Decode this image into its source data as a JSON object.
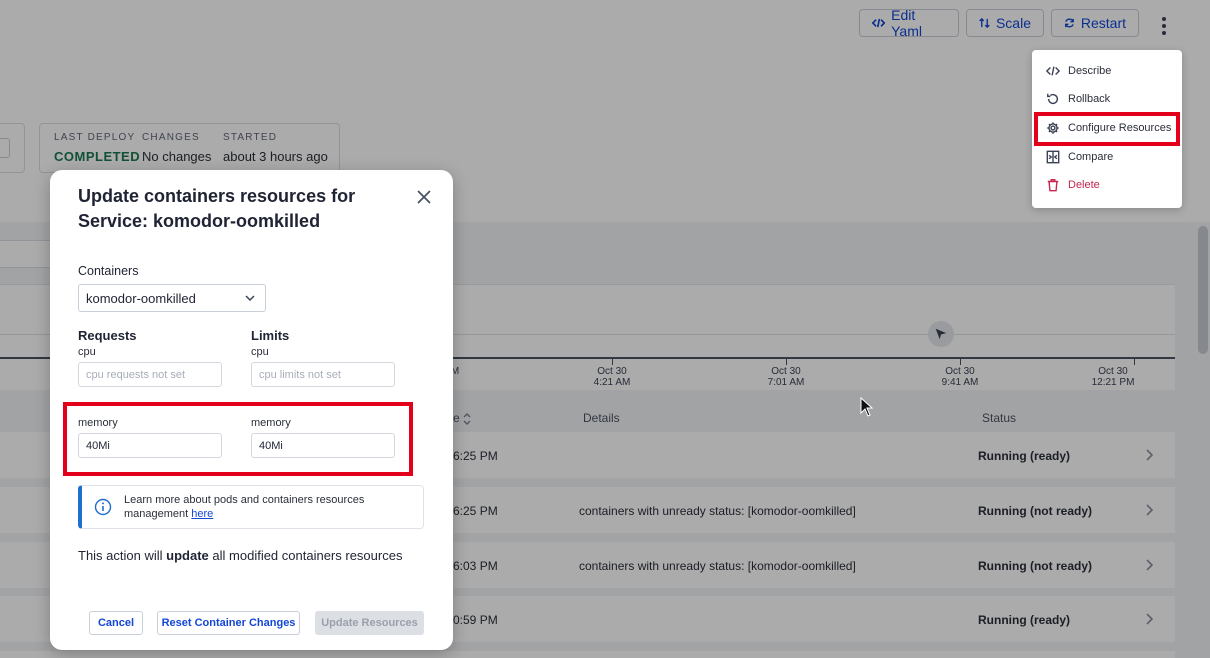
{
  "toolbar": {
    "edit_yaml": "Edit Yaml",
    "scale": "Scale",
    "restart": "Restart"
  },
  "deploy_info": {
    "last_deploy_label": "LAST DEPLOY",
    "last_deploy_value": "COMPLETED",
    "changes_label": "CHANGES",
    "changes_value": "No changes",
    "started_label": "STARTED",
    "started_value": "about 3 hours ago"
  },
  "timeline": {
    "ticks": [
      {
        "date": "",
        "time": "M"
      },
      {
        "date": "Oct 30",
        "time": "4:21 AM"
      },
      {
        "date": "Oct 30",
        "time": "7:01 AM"
      },
      {
        "date": "Oct 30",
        "time": "9:41 AM"
      },
      {
        "date": "Oct 30",
        "time": "12:21 PM"
      }
    ]
  },
  "table": {
    "headers": {
      "time": "e",
      "details": "Details",
      "status": "Status"
    },
    "rows": [
      {
        "time": "6:25 PM",
        "details": "",
        "status": "Running (ready)"
      },
      {
        "time": "6:25 PM",
        "details": "containers with unready status: [komodor-oomkilled]",
        "status": "Running (not ready)"
      },
      {
        "time": "6:03 PM",
        "details": "containers with unready status: [komodor-oomkilled]",
        "status": "Running (not ready)"
      },
      {
        "time": "0:59 PM",
        "details": "",
        "status": "Running (ready)"
      }
    ]
  },
  "menu": {
    "items": [
      {
        "label": "Describe",
        "icon": "code-icon"
      },
      {
        "label": "Rollback",
        "icon": "rollback-icon"
      },
      {
        "label": "Configure Resources",
        "icon": "gear-icon"
      },
      {
        "label": "Compare",
        "icon": "compare-icon"
      },
      {
        "label": "Delete",
        "icon": "trash-icon"
      }
    ]
  },
  "modal": {
    "title": "Update containers resources for Service: komodor-oomkilled",
    "containers_label": "Containers",
    "container_selected": "komodor-oomkilled",
    "requests_label": "Requests",
    "limits_label": "Limits",
    "cpu_label": "cpu",
    "cpu_requests_placeholder": "cpu requests not set",
    "cpu_limits_placeholder": "cpu limits not set",
    "memory_label": "memory",
    "memory_requests_value": "40Mi",
    "memory_limits_value": "40Mi",
    "info_text": "Learn more about pods and containers resources management",
    "info_link": "here",
    "action_prefix": "This action will",
    "action_bold": "update",
    "action_suffix": "all modified containers resources",
    "cancel": "Cancel",
    "reset": "Reset Container Changes",
    "update": "Update Resources"
  },
  "colors": {
    "accent": "#1347d6",
    "highlight": "#e3001b",
    "success": "#1b7a52",
    "danger": "#c8254f",
    "info": "#1f6fd1"
  }
}
